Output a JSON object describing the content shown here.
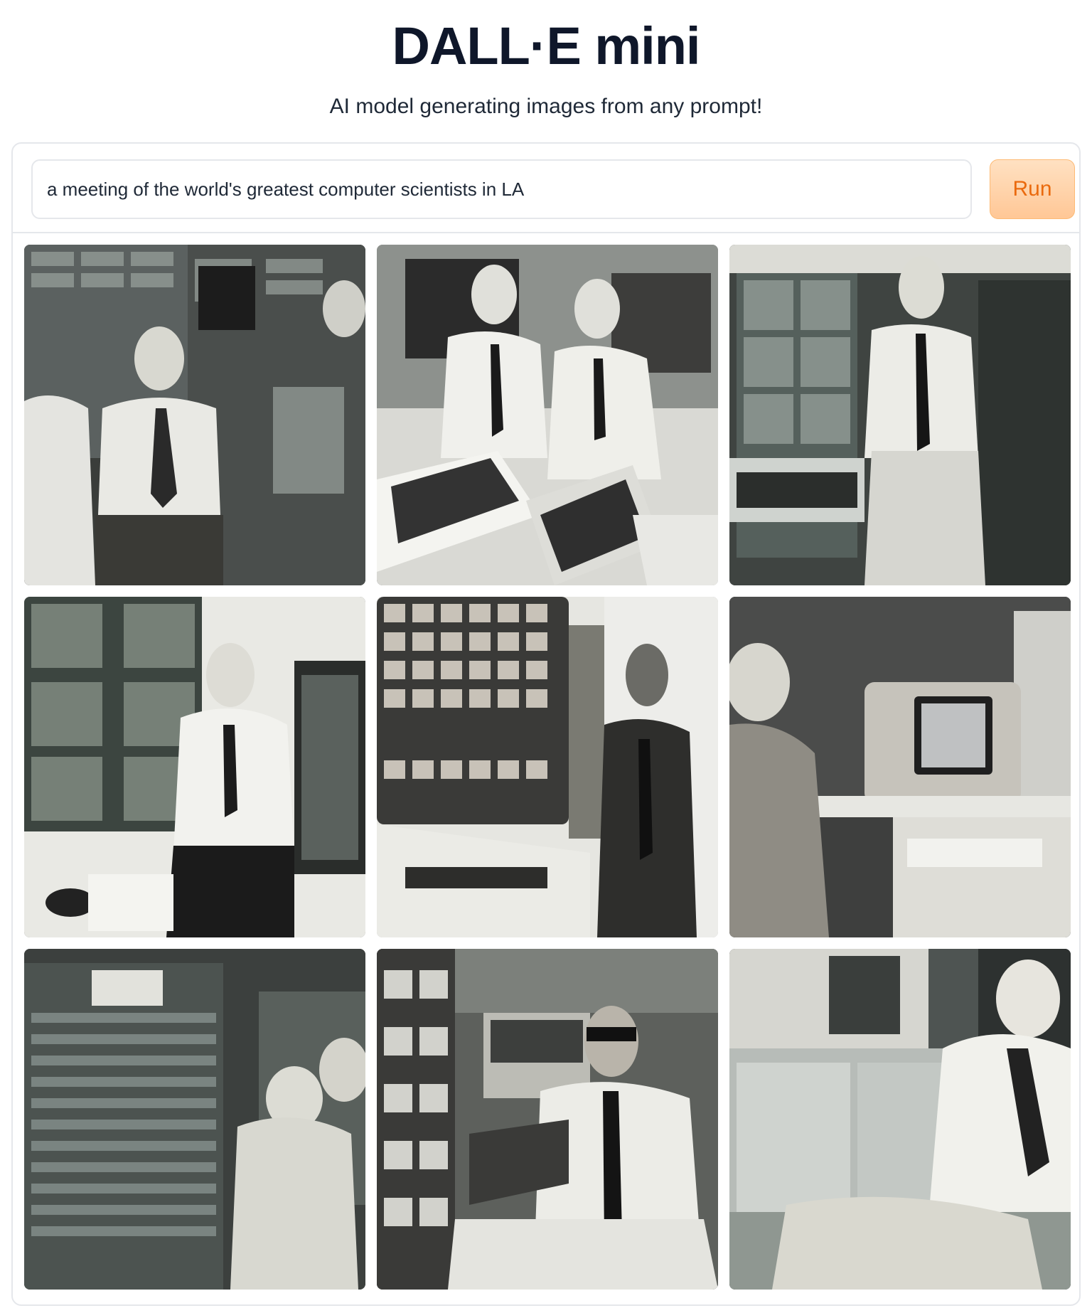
{
  "header": {
    "title": "DALL·E mini",
    "subtitle": "AI model generating images from any prompt!"
  },
  "prompt": {
    "value": "a meeting of the world's greatest computer scientists in LA",
    "run_label": "Run"
  },
  "gallery": {
    "images": [
      {
        "name": "generated-image-1",
        "depicts": "men in shirts and ties standing by mainframe panels"
      },
      {
        "name": "generated-image-2",
        "depicts": "two men at computer terminals with keyboards"
      },
      {
        "name": "generated-image-3",
        "depicts": "man seated beside computer cabinets"
      },
      {
        "name": "generated-image-4",
        "depicts": "man with glasses at a console with panels"
      },
      {
        "name": "generated-image-5",
        "depicts": "man in suit beside large keyboard machine"
      },
      {
        "name": "generated-image-6",
        "depicts": "person next to a beige computer monitor on a desk"
      },
      {
        "name": "generated-image-7",
        "depicts": "person seated in front of tall computer rack"
      },
      {
        "name": "generated-image-8",
        "depicts": "man with glasses holding a device near equipment"
      },
      {
        "name": "generated-image-9",
        "depicts": "man leaning over a large computer panel"
      }
    ]
  }
}
